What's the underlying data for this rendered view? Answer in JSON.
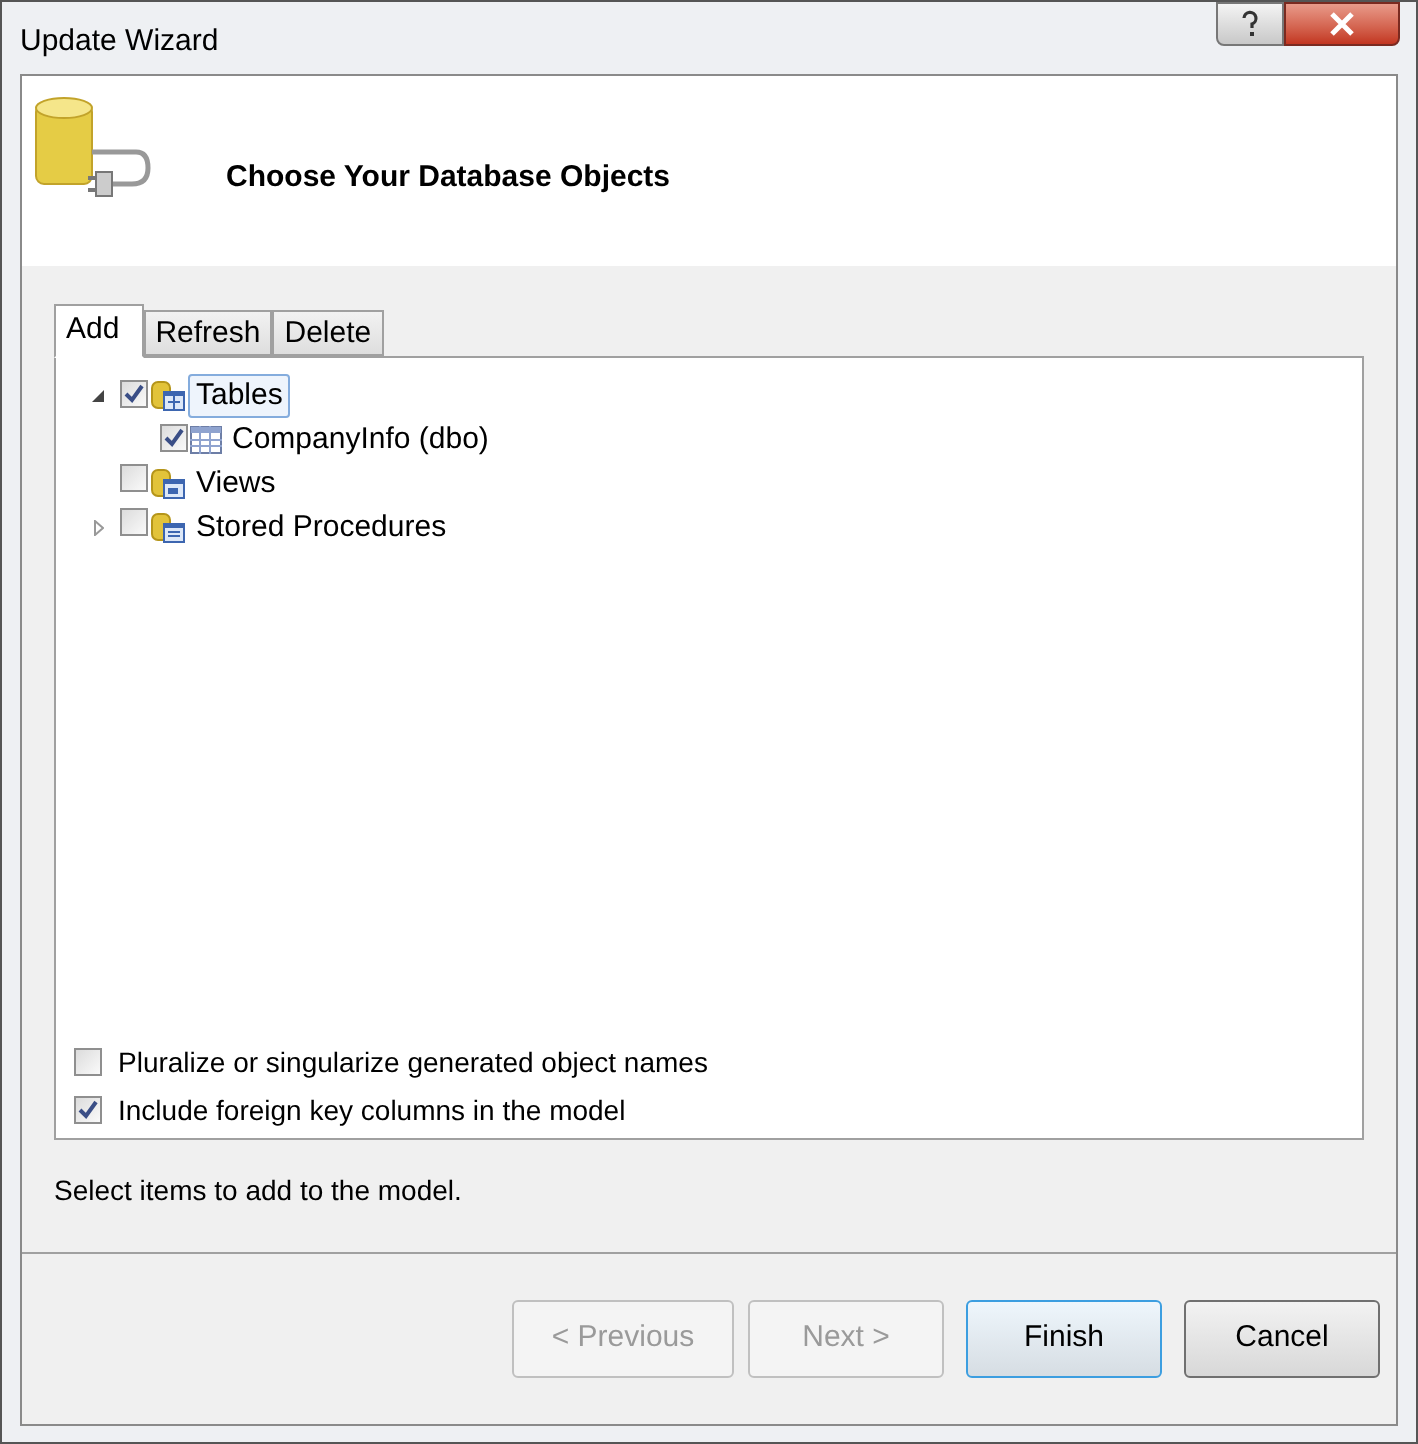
{
  "window": {
    "title": "Update Wizard"
  },
  "header": {
    "title": "Choose Your Database Objects"
  },
  "tabs": [
    {
      "label": "Add",
      "selected": true
    },
    {
      "label": "Refresh",
      "selected": false
    },
    {
      "label": "Delete",
      "selected": false
    }
  ],
  "tree": [
    {
      "label": "Tables",
      "kind": "tables",
      "checked": true,
      "selected": true,
      "expanded": true,
      "children": [
        {
          "label": "CompanyInfo (dbo)",
          "kind": "table",
          "checked": true,
          "selected": false
        }
      ]
    },
    {
      "label": "Views",
      "kind": "views",
      "checked": false,
      "selected": false
    },
    {
      "label": "Stored Procedures",
      "kind": "procedures",
      "checked": false,
      "selected": false,
      "expanded": false
    }
  ],
  "options": [
    {
      "label": "Pluralize or singularize generated object names",
      "checked": false
    },
    {
      "label": "Include foreign key columns in the model",
      "checked": true
    }
  ],
  "status": "Select items to add to the model.",
  "buttons": [
    {
      "label": "< Previous",
      "disabled": true,
      "default": false
    },
    {
      "label": "Next >",
      "disabled": true,
      "default": false
    },
    {
      "label": "Finish",
      "disabled": false,
      "default": true
    },
    {
      "label": "Cancel",
      "disabled": false,
      "default": false
    }
  ]
}
